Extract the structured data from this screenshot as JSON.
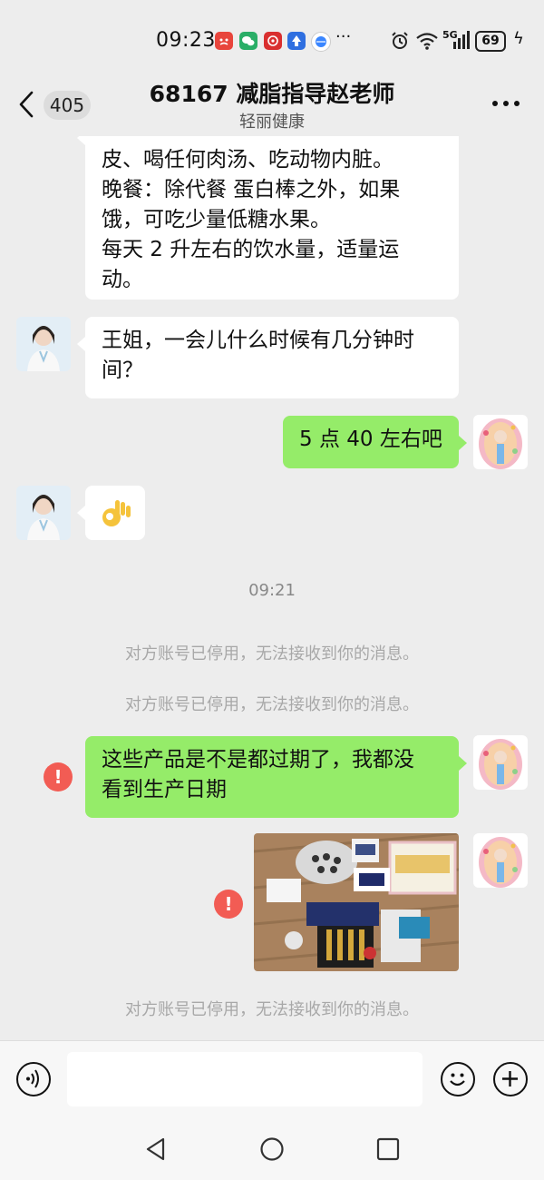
{
  "status_bar": {
    "time": "09:23",
    "notification_icons": [
      "weibo-icon",
      "wechat-icon",
      "app-red-icon",
      "app-blue-icon",
      "app-browser-icon"
    ],
    "more_dots": "···",
    "status_icons": [
      "alarm-icon",
      "wifi-icon",
      "5g-signal-icon"
    ],
    "network_label": "5G",
    "battery_level": "69"
  },
  "header": {
    "unread_count": "405",
    "title": "68167 减脂指导赵老师",
    "subtitle": "轻丽健康"
  },
  "messages": [
    {
      "side": "in",
      "lines": [
        "皮、喝任何肉汤、吃动物内脏。",
        "晚餐：除代餐 蛋白棒之外，如果",
        "饿，可吃少量低糖水果。",
        "每天 2 升左右的饮水量，适量运",
        "动。"
      ]
    },
    {
      "side": "in",
      "lines": [
        "王姐，一会儿什么时候有几分钟时",
        "间？"
      ]
    },
    {
      "side": "out",
      "lines": [
        "5 点 40 左右吧"
      ]
    },
    {
      "side": "in",
      "emoji": "👌"
    },
    {
      "side": "out",
      "lines": [
        "这些产品是不是都过期了，我都没",
        "看到生产日期"
      ],
      "error_mark": "!"
    }
  ],
  "timestamp": "09:21",
  "system_notice": "对方账号已停用，无法接收到你的消息。",
  "image_error_mark": "!",
  "colors": {
    "background": "#ededed",
    "outgoing_bubble": "#95ec69",
    "incoming_bubble": "#ffffff",
    "error_red": "#f25c54"
  }
}
